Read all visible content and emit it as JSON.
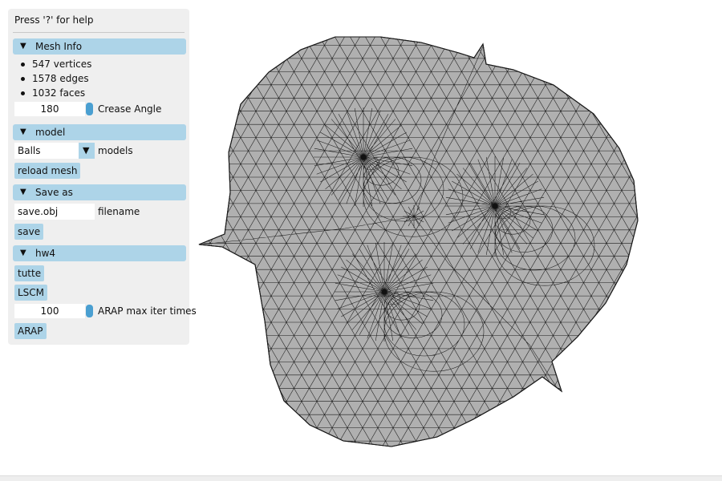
{
  "help_text": "Press '?' for help",
  "mesh_info": {
    "header": "Mesh Info",
    "vertices": "547 vertices",
    "edges": "1578 edges",
    "faces": "1032 faces",
    "crease_angle_value": "180",
    "crease_angle_label": "Crease Angle"
  },
  "model": {
    "header": "model",
    "selected_model": "Balls",
    "models_label": "models",
    "reload_label": "reload mesh"
  },
  "save_as": {
    "header": "Save as",
    "filename_value": "save.obj",
    "filename_label": "filename",
    "save_label": "save"
  },
  "hw4": {
    "header": "hw4",
    "tutte_label": "tutte",
    "lscm_label": "LSCM",
    "arap_iter_value": "100",
    "arap_iter_label": "ARAP max iter times",
    "arap_label": "ARAP"
  },
  "icons": {
    "collapse": "triangle-down-icon",
    "dropdown": "triangle-down-icon"
  },
  "colors": {
    "header_bg": "#add4e8",
    "slider_knob": "#4a9fd1",
    "panel_bg": "#efefef",
    "mesh_fill": "#b0b0b0",
    "mesh_line": "#1a1a1a"
  }
}
